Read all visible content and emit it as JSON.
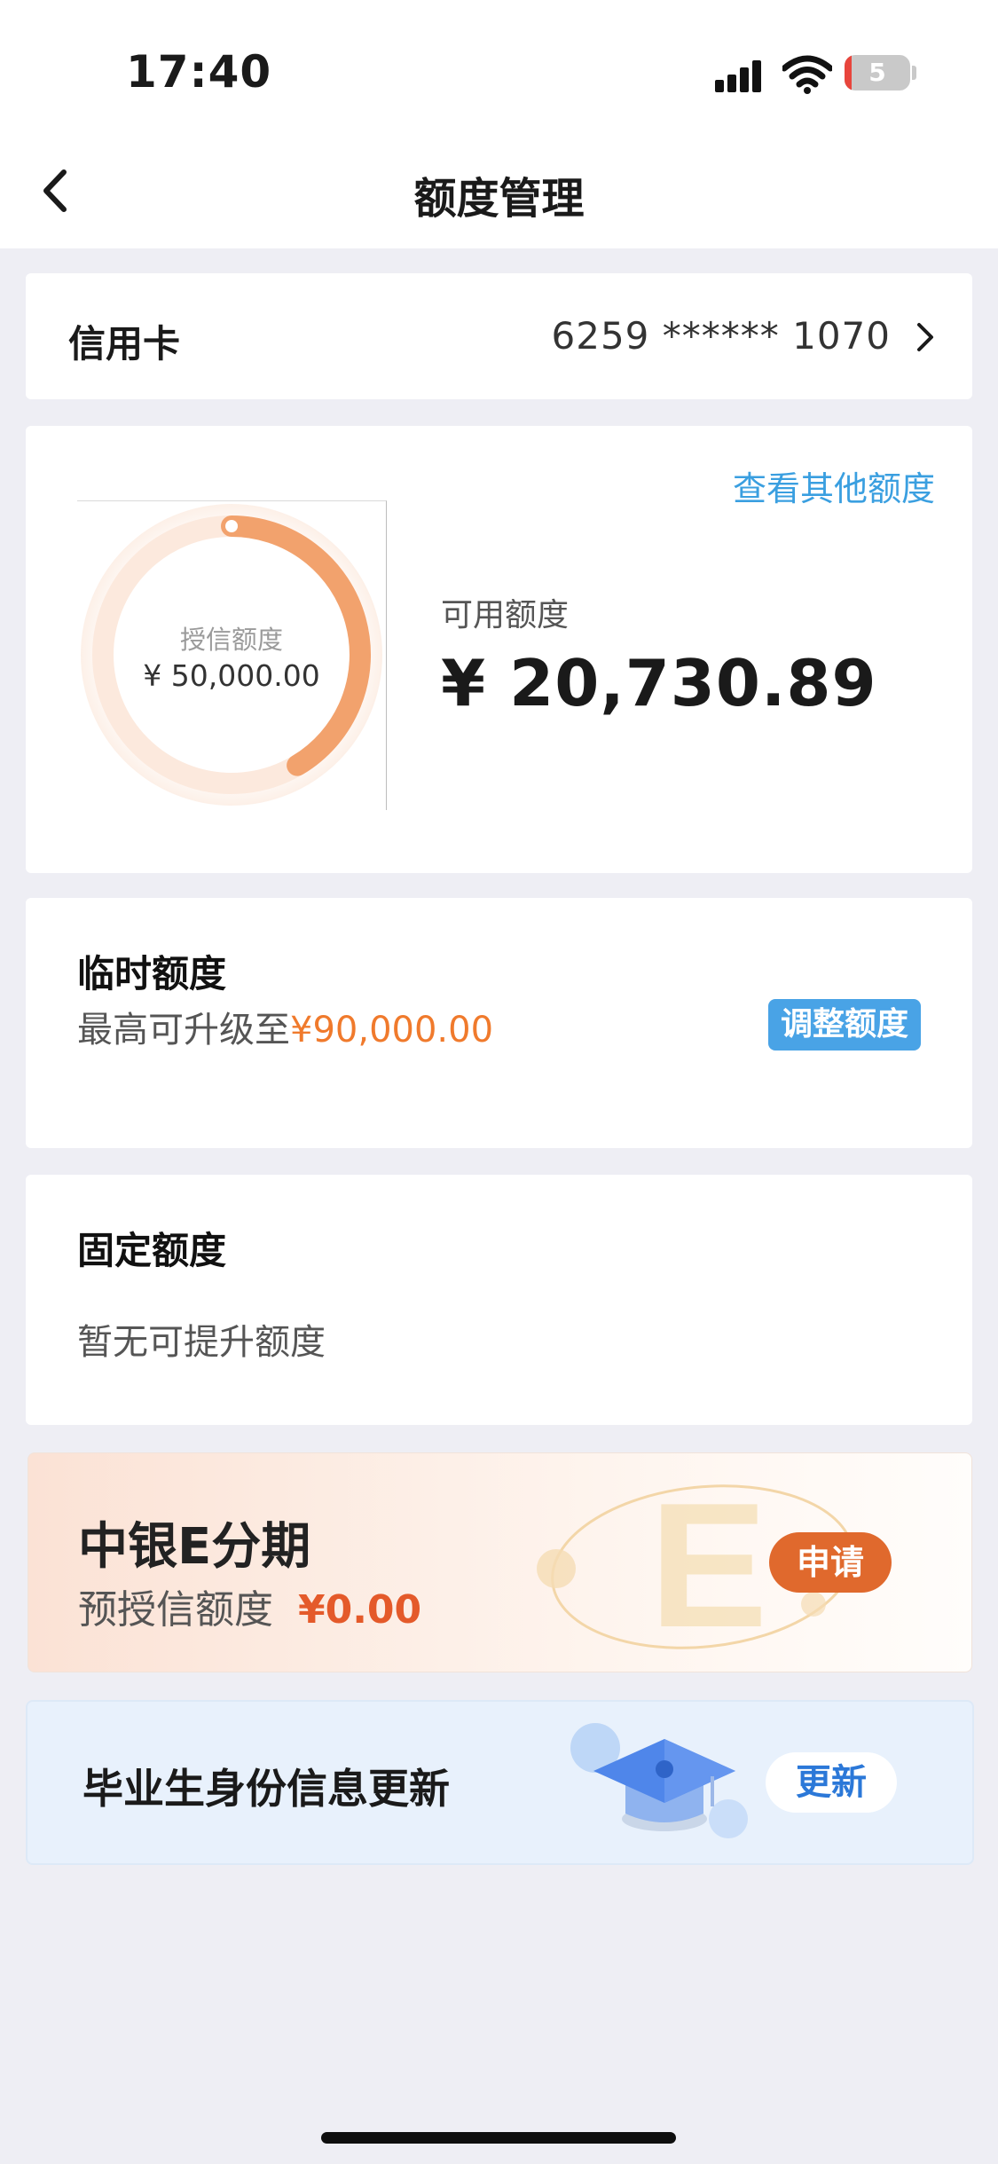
{
  "status_bar": {
    "time": "17:40",
    "battery": "5"
  },
  "nav": {
    "title": "额度管理",
    "back_icon": "chevron-left-icon"
  },
  "card_row": {
    "label": "信用卡",
    "number": "6259 ****** 1070"
  },
  "limit_summary": {
    "other_link": "查看其他额度",
    "credit_label": "授信额度",
    "credit_value": "¥ 50,000.00",
    "available_label": "可用额度",
    "available_value": "¥ 20,730.89",
    "available_fraction": 0.4146,
    "ring_color": "#f2a26d"
  },
  "temporary": {
    "title": "临时额度",
    "subtitle_prefix": "最高可升级至",
    "subtitle_amount": "¥90,000.00",
    "button": "调整额度"
  },
  "fixed": {
    "title": "固定额度",
    "subtitle": "暂无可提升额度"
  },
  "installment": {
    "title": "中银E分期",
    "subtitle_label": "预授信额度",
    "subtitle_amount": "¥0.00",
    "button": "申请",
    "watermark": "E"
  },
  "graduate": {
    "title": "毕业生身份信息更新",
    "button": "更新"
  },
  "colors": {
    "accent_blue": "#3a9fe0",
    "accent_orange": "#f07a2c",
    "apply_orange": "#e0692d"
  }
}
